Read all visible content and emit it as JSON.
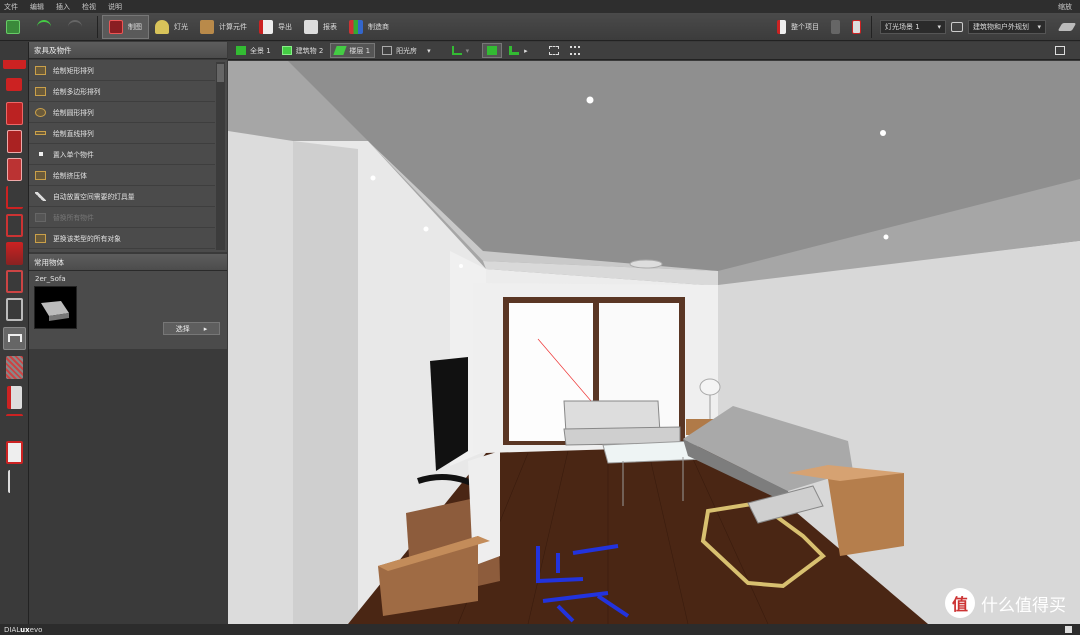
{
  "menu": {
    "items": [
      "文件",
      "编辑",
      "插入",
      "检视",
      "说明"
    ],
    "zoom": "缩放"
  },
  "toolbar": {
    "tools": [
      {
        "label": "制图",
        "icon": "draw-icon",
        "active": true
      },
      {
        "label": "灯光",
        "icon": "lamp-icon",
        "active": false
      },
      {
        "label": "计算元件",
        "icon": "calc-icon",
        "active": false
      },
      {
        "label": "导出",
        "icon": "export-icon",
        "active": false
      },
      {
        "label": "报表",
        "icon": "report-icon",
        "active": false
      },
      {
        "label": "制造商",
        "icon": "manufacturer-icon",
        "active": false
      }
    ],
    "project_label": "整个项目",
    "light_scene": "灯光场景 1",
    "planning": "建筑物和户外规划"
  },
  "panel": {
    "title": "家具及物件",
    "actions": [
      {
        "label": "绘制矩形排列",
        "enabled": true
      },
      {
        "label": "绘制多边形排列",
        "enabled": true
      },
      {
        "label": "绘制圆形排列",
        "enabled": true
      },
      {
        "label": "绘制直线排列",
        "enabled": true
      },
      {
        "label": "置入单个物件",
        "enabled": true
      },
      {
        "label": "绘制挤压体",
        "enabled": true
      },
      {
        "label": "自动放置空间需要的灯具量",
        "enabled": true
      },
      {
        "label": "替换所有物件",
        "enabled": false
      },
      {
        "label": "更换该类型的所有对象",
        "enabled": true
      }
    ],
    "used_title": "常用物体",
    "used_item": "2er_Sofa",
    "choose": "选择"
  },
  "viewtabs": [
    {
      "label": "全景 1",
      "active": false
    },
    {
      "label": "建筑物 2",
      "active": false
    },
    {
      "label": "楼层 1",
      "active": true
    },
    {
      "label": "阳光房",
      "active": false
    }
  ],
  "status": {
    "brand_prefix": "DIAL",
    "brand_bold": "ux",
    "brand_suffix": "evo"
  },
  "watermark": {
    "logo": "值",
    "text": "什么值得买"
  },
  "colors": {
    "accent_red": "#c0262c",
    "accent_green": "#2aa63a",
    "floor": "#4a2614",
    "wood": "#b07a48"
  }
}
